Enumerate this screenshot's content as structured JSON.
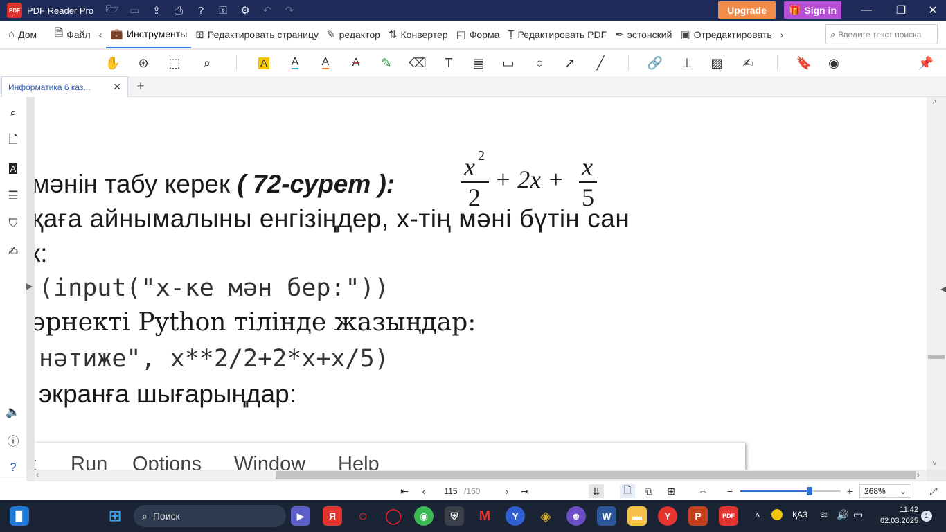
{
  "titlebar": {
    "app_name": "PDF Reader Pro",
    "logo_text": "PDF",
    "upgrade_label": "Upgrade",
    "signin_label": "Sign in"
  },
  "menu": {
    "tabs": [
      {
        "label": "Дом",
        "icon": "home-icon"
      },
      {
        "label": "Файл",
        "icon": "file-icon"
      },
      {
        "label": "Инструменты",
        "icon": "toolbox-icon",
        "active": true
      },
      {
        "label": "Редактировать страницу",
        "icon": "grid-icon"
      },
      {
        "label": "редактор",
        "icon": "edit-icon"
      },
      {
        "label": "Конвертер",
        "icon": "convert-icon"
      },
      {
        "label": "Форма",
        "icon": "form-icon"
      },
      {
        "label": "Редактировать PDF",
        "icon": "text-cursor-icon"
      },
      {
        "label": "эстонский",
        "icon": "pen-icon"
      },
      {
        "label": "Отредактировать",
        "icon": "redact-icon"
      }
    ],
    "search_placeholder": "Введите текст поиска"
  },
  "document_tab": {
    "title": "Информатика 6 каз..."
  },
  "document": {
    "line1_text": "мәнін табу керек ",
    "line1_ref": "( 72-сурет ):",
    "formula": {
      "num1": "x",
      "exp": "2",
      "den1": "2",
      "middle": "+ 2x +",
      "num2": "x",
      "den2": "5"
    },
    "line2": "қаға айнымалыны енгізіңдер, x-тің мәні бүтін сан",
    "line3": "к:",
    "line4": "(input(\"x-ке мән бер:\"))",
    "line5": "өрнекті Python тілінде жазыңдар:",
    "line6": "нәтиже\", x**2/2+2*x+x/5)",
    "line7": "экранға шығарыңдар:",
    "idle_menu": [
      "t",
      "Run",
      "Options",
      "Window",
      "Help"
    ]
  },
  "statusbar": {
    "current_page": "115",
    "total_pages": "/160",
    "zoom": "268%",
    "zoom_fraction": 0.69
  },
  "taskbar": {
    "search_label": "Поиск",
    "language": "ҚАЗ",
    "time": "11:42",
    "date": "02.03.2025",
    "notifications": "1"
  }
}
